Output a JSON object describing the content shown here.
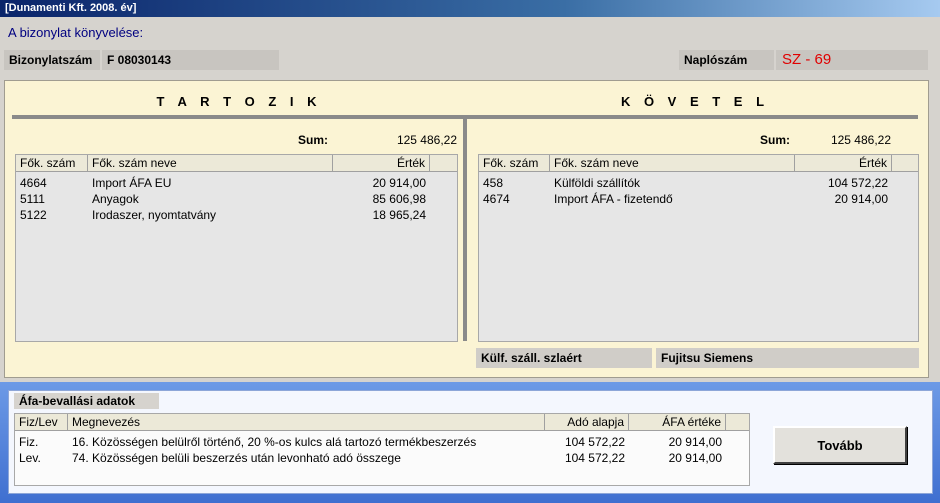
{
  "window": {
    "title": "[Dunamenti Kft.   2008. év]"
  },
  "heading": "A bizonylat könyvelése:",
  "doc": {
    "label": "Bizonylatszám",
    "value": "F 08030143"
  },
  "journal": {
    "label": "Naplószám",
    "value": "SZ - 69"
  },
  "debit": {
    "title": "T A R T O Z I K",
    "sum_label": "Sum:",
    "sum_value": "125 486,22",
    "columns": [
      "Fők. szám",
      "Fők. szám neve",
      "Érték"
    ],
    "rows": [
      {
        "code": "4664",
        "name": "Import ÁFA EU",
        "value": "20 914,00"
      },
      {
        "code": "5111",
        "name": "Anyagok",
        "value": "85 606,98"
      },
      {
        "code": "5122",
        "name": "Irodaszer, nyomtatvány",
        "value": "18 965,24"
      }
    ]
  },
  "credit": {
    "title": "K Ö V E T E L",
    "sum_label": "Sum:",
    "sum_value": "125 486,22",
    "columns": [
      "Fők. szám",
      "Fők. szám neve",
      "Érték"
    ],
    "rows": [
      {
        "code": "458",
        "name": "Külföldi szállítók",
        "value": "104 572,22"
      },
      {
        "code": "4674",
        "name": "Import ÁFA - fizetendő",
        "value": "20 914,00"
      }
    ]
  },
  "supplier": {
    "label": "Külf. száll. szlaért",
    "value": "Fujitsu Siemens"
  },
  "vat": {
    "title": "Áfa-bevallási adatok",
    "columns": [
      "Fiz/Lev",
      "Megnevezés",
      "Adó alapja",
      "ÁFA értéke"
    ],
    "rows": [
      {
        "type": "Fiz.",
        "desc": "16.  Közösségen belülről történő, 20 %-os kulcs alá tartozó termékbeszerzés",
        "base": "104 572,22",
        "vat": "20 914,00"
      },
      {
        "type": "Lev.",
        "desc": "74.  Közösségen belüli beszerzés után levonható adó összege",
        "base": "104 572,22",
        "vat": "20 914,00"
      }
    ]
  },
  "buttons": {
    "next": "Tovább"
  },
  "colors": {
    "panel": "#fbf4d4",
    "accent": "#000080",
    "journal": "#e00000",
    "vat_bg": "#4f7fdc"
  }
}
